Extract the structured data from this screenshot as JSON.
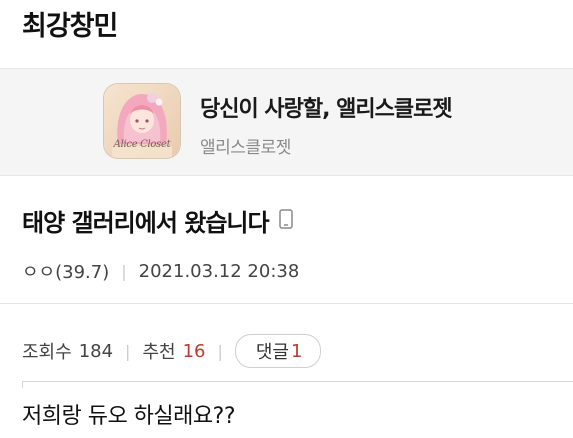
{
  "board": {
    "title": "최강창민"
  },
  "ad": {
    "icon_text": "Alice Closet",
    "title": "당신이 사랑할, 앨리스클로젯",
    "subtitle": "앨리스클로젯"
  },
  "post": {
    "title": "태양 갤러리에서 왔습니다",
    "author": "ㅇㅇ(39.7)",
    "datetime": "2021.03.12 20:38",
    "body": "저희랑 듀오 하실래요??"
  },
  "stats": {
    "views_label": "조회수",
    "views": "184",
    "recommend_label": "추천",
    "recommend": "16",
    "comments_label": "댓글",
    "comments": "1"
  },
  "colors": {
    "accent_red": "#c0392b",
    "ad_bg": "#f5f5f5"
  },
  "icons": {
    "mobile": "mobile-phone-icon"
  }
}
